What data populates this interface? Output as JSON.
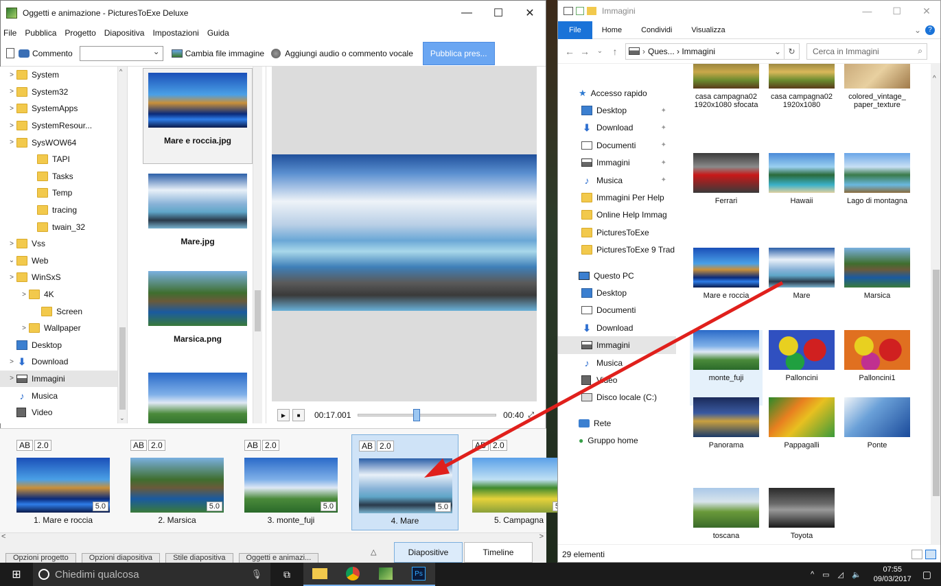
{
  "pte": {
    "title": "Oggetti e animazione - PicturesToExe Deluxe",
    "window_buttons": [
      "—",
      "☐",
      "✕"
    ],
    "menu": [
      "File",
      "Pubblica",
      "Progetto",
      "Diapositiva",
      "Impostazioni",
      "Guida"
    ],
    "toolbar": {
      "comment": "Commento",
      "change_image": "Cambia file immagine",
      "add_audio": "Aggiungi audio o commento vocale",
      "publish": "Pubblica pres..."
    },
    "tree": [
      {
        "label": "System",
        "chev": ">"
      },
      {
        "label": "System32",
        "chev": ">"
      },
      {
        "label": "SystemApps",
        "chev": ">"
      },
      {
        "label": "SystemResour...",
        "chev": ">"
      },
      {
        "label": "SysWOW64",
        "chev": ">"
      },
      {
        "label": "TAPI",
        "chev": ""
      },
      {
        "label": "Tasks",
        "chev": ""
      },
      {
        "label": "Temp",
        "chev": ""
      },
      {
        "label": "tracing",
        "chev": ""
      },
      {
        "label": "twain_32",
        "chev": ""
      },
      {
        "label": "Vss",
        "chev": ">"
      },
      {
        "label": "Web",
        "chev": "⌄"
      },
      {
        "label": "WinSxS",
        "chev": ">"
      },
      {
        "label": "4K",
        "chev": ">"
      },
      {
        "label": "Screen",
        "chev": ""
      },
      {
        "label": "Wallpaper",
        "chev": ">"
      },
      {
        "label": "Desktop",
        "chev": ""
      },
      {
        "label": "Download",
        "chev": ">"
      },
      {
        "label": "Immagini",
        "chev": ">"
      },
      {
        "label": "Musica",
        "chev": ""
      },
      {
        "label": "Video",
        "chev": ""
      }
    ],
    "thumbs": [
      "Mare e roccia.jpg",
      "Mare.jpg",
      "Marsica.png"
    ],
    "time_current": "00:17.001",
    "time_total": "00:40",
    "slides": [
      {
        "ab": "AB",
        "trans": "2.0",
        "dur": "5.0",
        "label": "1. Mare e roccia"
      },
      {
        "ab": "AB",
        "trans": "2.0",
        "dur": "5.0",
        "label": "2. Marsica"
      },
      {
        "ab": "AB",
        "trans": "2.0",
        "dur": "5.0",
        "label": "3. monte_fuji"
      },
      {
        "ab": "AB",
        "trans": "2.0",
        "dur": "5.0",
        "label": "4. Mare"
      },
      {
        "ab": "AB",
        "trans": "2.0",
        "dur": "5.",
        "label": "5. Campagna"
      }
    ],
    "bottom_buttons": [
      "Opzioni progetto",
      "Opzioni diapositiva",
      "Stile diapositiva",
      "Oggetti e animazi..."
    ],
    "tabs": [
      "Diapositive",
      "Timeline"
    ]
  },
  "explorer": {
    "title": "Immagini",
    "ribbon": [
      "File",
      "Home",
      "Condividi",
      "Visualizza"
    ],
    "address": "Ques... › Immagini",
    "search_placeholder": "Cerca in Immagini",
    "nav": [
      {
        "label": "Accesso rapido",
        "kind": "star"
      },
      {
        "label": "Desktop",
        "kind": "pin"
      },
      {
        "label": "Download",
        "kind": "pin"
      },
      {
        "label": "Documenti",
        "kind": "pin"
      },
      {
        "label": "Immagini",
        "kind": "pin"
      },
      {
        "label": "Musica",
        "kind": "pin"
      },
      {
        "label": "Immagini Per Help",
        "kind": "folder"
      },
      {
        "label": "Online Help Immag",
        "kind": "folder"
      },
      {
        "label": "PicturesToExe",
        "kind": "folder"
      },
      {
        "label": "PicturesToExe 9 Trad",
        "kind": "folder"
      },
      {
        "label": "Questo PC",
        "kind": "pc"
      },
      {
        "label": "Desktop",
        "kind": "pcsub"
      },
      {
        "label": "Documenti",
        "kind": "pcsub"
      },
      {
        "label": "Download",
        "kind": "pcsub"
      },
      {
        "label": "Immagini",
        "kind": "pcsub"
      },
      {
        "label": "Musica",
        "kind": "pcsub"
      },
      {
        "label": "Video",
        "kind": "pcsub"
      },
      {
        "label": "Disco locale (C:)",
        "kind": "pcsub"
      },
      {
        "label": "Rete",
        "kind": "net"
      },
      {
        "label": "Gruppo home",
        "kind": "home"
      }
    ],
    "tiles": [
      {
        "label": "casa campagna02 1920x1080 sfocata"
      },
      {
        "label": "casa campagna02 1920x1080"
      },
      {
        "label": "colored_vintage_ paper_texture"
      },
      {
        "label": "Ferrari"
      },
      {
        "label": "Hawaii"
      },
      {
        "label": "Lago di montagna"
      },
      {
        "label": "Mare e roccia"
      },
      {
        "label": "Mare"
      },
      {
        "label": "Marsica"
      },
      {
        "label": "monte_fuji"
      },
      {
        "label": "Palloncini"
      },
      {
        "label": "Palloncini1"
      },
      {
        "label": "Panorama"
      },
      {
        "label": "Pappagalli"
      },
      {
        "label": "Ponte"
      },
      {
        "label": "toscana"
      },
      {
        "label": "Toyota"
      }
    ],
    "status": "29 elementi"
  },
  "taskbar": {
    "search": "Chiedimi qualcosa",
    "time": "07:55",
    "date": "09/03/2017"
  },
  "colors": {
    "accent": "#1a73d8",
    "selection": "#cfe3f7",
    "arrow": "#e0201c"
  }
}
